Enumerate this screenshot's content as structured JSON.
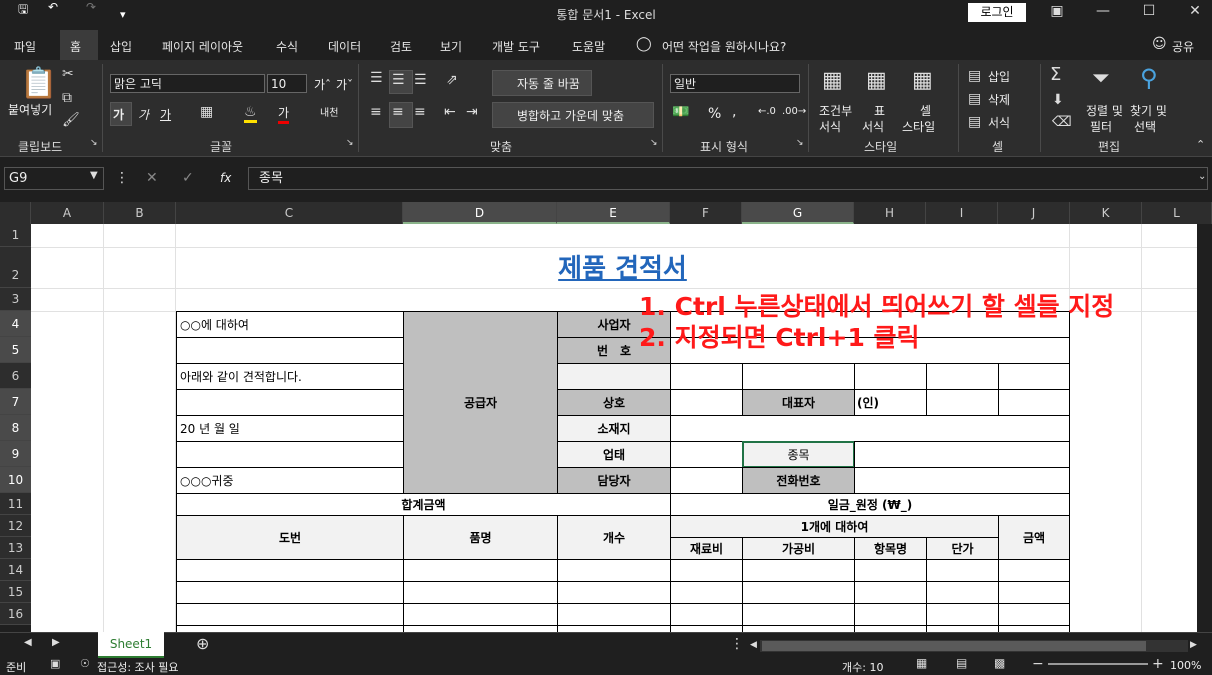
{
  "titlebar": {
    "title": "통합 문서1  -  Excel",
    "login_label": "로그인"
  },
  "tabs": [
    "파일",
    "홈",
    "삽입",
    "페이지 레이아웃",
    "수식",
    "데이터",
    "검토",
    "보기",
    "개발 도구",
    "도움말"
  ],
  "tell_me": "어떤 작업을 원하시나요?",
  "share_label": "공유",
  "ribbon": {
    "clipboard": {
      "paste_label": "붙여넣기",
      "group_label": "클립보드"
    },
    "font": {
      "font_name": "맑은 고딕",
      "font_size": "10",
      "bold": "가",
      "italic": "가",
      "underline": "가",
      "group_label": "글꼴"
    },
    "alignment": {
      "wrap_text": "자동 줄 바꿈",
      "merge_center": "병합하고 가운데 맞춤",
      "group_label": "맞춤"
    },
    "number": {
      "format": "일반",
      "percent": "%",
      "comma": ",",
      "group_label": "표시 형식"
    },
    "styles": {
      "conditional": "조건부",
      "conditional2": "서식",
      "table": "표",
      "table2": "서식",
      "cell": "셀",
      "cell2": "스타일",
      "group_label": "스타일"
    },
    "cells": {
      "insert": "삽입",
      "delete": "삭제",
      "format": "서식",
      "group_label": "셀"
    },
    "editing": {
      "sort": "정렬 및",
      "sort2": "필터",
      "find": "찾기 및",
      "find2": "선택",
      "group_label": "편집"
    }
  },
  "formula_bar": {
    "name_box": "G9",
    "fx": "fx",
    "content": "종목"
  },
  "columns": [
    "A",
    "B",
    "C",
    "D",
    "E",
    "F",
    "G",
    "H",
    "I",
    "J",
    "K",
    "L"
  ],
  "rows": [
    "1",
    "2",
    "3",
    "4",
    "5",
    "6",
    "7",
    "8",
    "9",
    "10",
    "11",
    "12",
    "13",
    "14",
    "15",
    "16"
  ],
  "sheet": {
    "doc_title": "제품 견적서",
    "annotation1": "1. Ctrl 누른상태에서 띄어쓰기 할 셀들 지정",
    "annotation2": "2. 지정되면 Ctrl+1 클릭",
    "c4": "○○에 대하여",
    "c6": "아래와 같이 견적합니다.",
    "c8": "20 년 월 일",
    "c10": "○○○귀중",
    "d_supplier": "공급자",
    "e4": "사업자",
    "e5": "번　호",
    "e7": "상호",
    "e8": "소재지",
    "e9": "업태",
    "e10": "담당자",
    "g7": "대표자",
    "h7": "(인)",
    "g9": "종목",
    "g10": "전화번호",
    "total_label": "합계금액",
    "total_value": "일금_원정 (₩_)",
    "h_drawing": "도번",
    "h_name": "품명",
    "h_count": "개수",
    "h_per_unit": "1개에 대하여",
    "h_material": "재료비",
    "h_processing": "가공비",
    "h_item": "항목명",
    "h_unitprice": "단가",
    "h_amount": "금액"
  },
  "sheet_tab": "Sheet1",
  "status": {
    "ready": "준비",
    "accessibility": "접근성: 조사 필요",
    "count": "개수: 10",
    "zoom": "100%"
  }
}
